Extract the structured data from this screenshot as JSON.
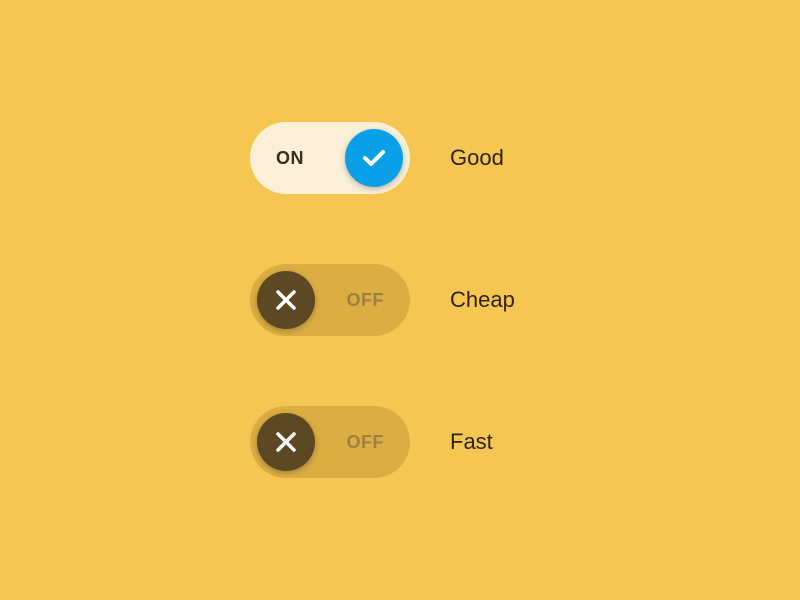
{
  "toggles": [
    {
      "state": "on",
      "state_label": "ON",
      "label": "Good",
      "icon": "check",
      "knob_color": "#0aa0e8",
      "track_color": "#faf0d8"
    },
    {
      "state": "off",
      "state_label": "OFF",
      "label": "Cheap",
      "icon": "cross",
      "knob_color": "#5c4822",
      "track_color": "#dbad43"
    },
    {
      "state": "off",
      "state_label": "OFF",
      "label": "Fast",
      "icon": "cross",
      "knob_color": "#5c4822",
      "track_color": "#dbad43"
    }
  ],
  "colors": {
    "background": "#f5c652",
    "label_text": "#2e2414"
  }
}
